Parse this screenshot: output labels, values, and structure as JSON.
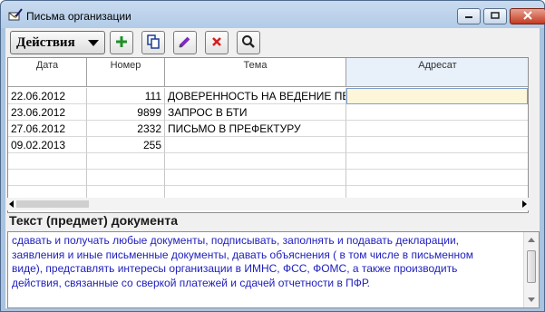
{
  "window": {
    "title": "Письма организации",
    "icon": "envelope-pen-icon"
  },
  "toolbar": {
    "actions_label": "Действия",
    "buttons": [
      {
        "name": "add",
        "icon": "plus-icon",
        "color": "#1f8f2a"
      },
      {
        "name": "copy",
        "icon": "copy-icon",
        "color": "#1d3d8f"
      },
      {
        "name": "edit",
        "icon": "pencil-icon",
        "color": "#7b2cbf"
      },
      {
        "name": "delete",
        "icon": "x-icon",
        "color": "#d42020"
      },
      {
        "name": "search",
        "icon": "magnifier-icon",
        "color": "#222222"
      }
    ]
  },
  "grid": {
    "columns": [
      "Дата",
      "Номер",
      "Тема",
      "Адресат"
    ],
    "rows": [
      {
        "date": "22.06.2012",
        "number": "111",
        "subject": "ДОВЕРЕННОСТЬ НА ВЕДЕНИЕ ПЕРЕГ",
        "addressee": ""
      },
      {
        "date": "23.06.2012",
        "number": "9899",
        "subject": "ЗАПРОС В БТИ",
        "addressee": ""
      },
      {
        "date": "27.06.2012",
        "number": "2332",
        "subject": "ПИСЬМО В ПРЕФЕКТУРУ",
        "addressee": ""
      },
      {
        "date": "09.02.2013",
        "number": "255",
        "subject": "",
        "addressee": ""
      }
    ]
  },
  "document_text": {
    "label": "Текст (предмет) документа",
    "line1": "сдавать и получать любые документы, подписывать, заполнять и подавать декларации,",
    "line2": "заявления и иные письменные документы, давать объяснения ( в том числе в письменном",
    "line3": "виде), представлять интересы организации в ИМНС, ФСС, ФОМС, а также производить",
    "line4": "действия, связанные со сверкой платежей и сдачей отчетности в ПФР."
  }
}
